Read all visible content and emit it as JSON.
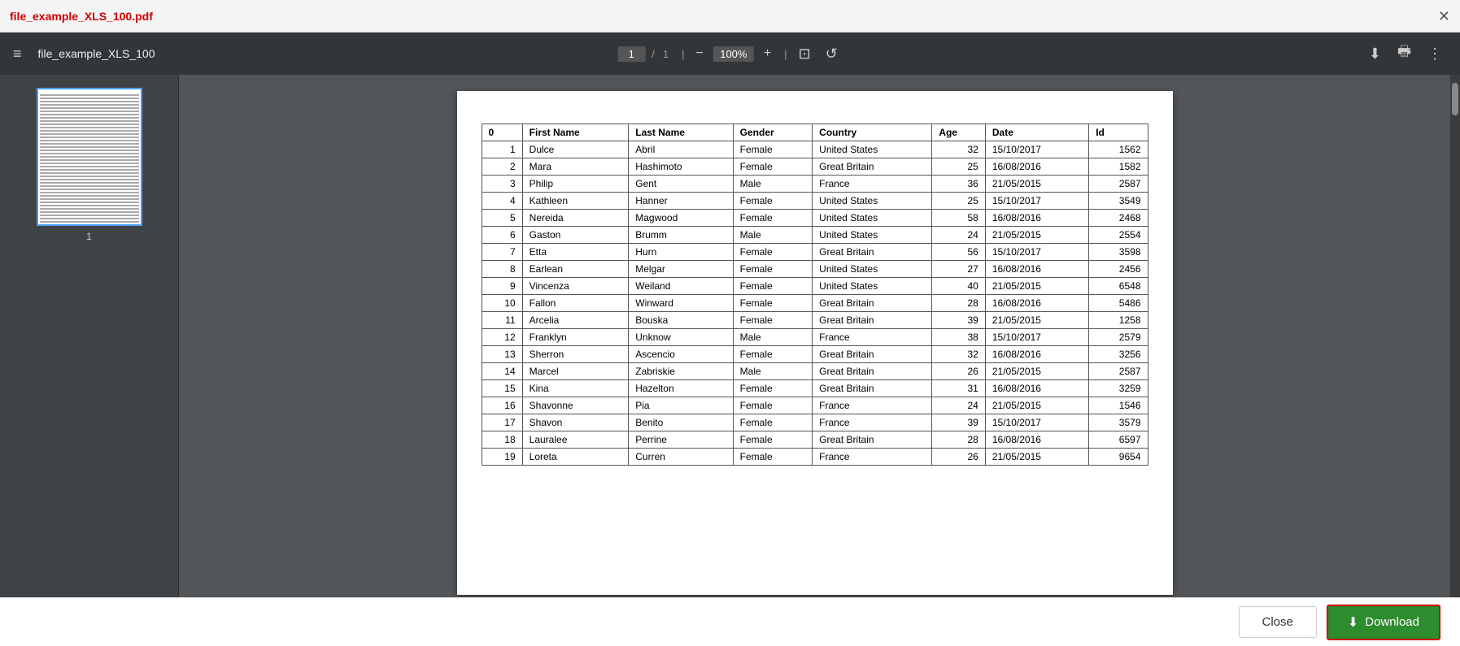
{
  "titleBar": {
    "filename": "file_example_XLS_100.pdf",
    "closeLabel": "✕"
  },
  "toolbar": {
    "hamburgerIcon": "≡",
    "filename": "file_example_XLS_100",
    "currentPage": "1",
    "totalPages": "1",
    "zoomPercent": "100%",
    "zoomOutLabel": "−",
    "zoomInLabel": "+",
    "fitPageIcon": "⊡",
    "rotateIcon": "↺",
    "downloadIcon": "⬇",
    "printIcon": "🖶",
    "moreIcon": "⋮"
  },
  "sidebar": {
    "pageNumber": "1"
  },
  "table": {
    "headers": [
      "0",
      "First Name",
      "Last Name",
      "Gender",
      "Country",
      "Age",
      "Date",
      "Id"
    ],
    "rows": [
      [
        "1",
        "Dulce",
        "Abril",
        "Female",
        "United States",
        "32",
        "15/10/2017",
        "1562"
      ],
      [
        "2",
        "Mara",
        "Hashimoto",
        "Female",
        "Great Britain",
        "25",
        "16/08/2016",
        "1582"
      ],
      [
        "3",
        "Philip",
        "Gent",
        "Male",
        "France",
        "36",
        "21/05/2015",
        "2587"
      ],
      [
        "4",
        "Kathleen",
        "Hanner",
        "Female",
        "United States",
        "25",
        "15/10/2017",
        "3549"
      ],
      [
        "5",
        "Nereida",
        "Magwood",
        "Female",
        "United States",
        "58",
        "16/08/2016",
        "2468"
      ],
      [
        "6",
        "Gaston",
        "Brumm",
        "Male",
        "United States",
        "24",
        "21/05/2015",
        "2554"
      ],
      [
        "7",
        "Etta",
        "Hurn",
        "Female",
        "Great Britain",
        "56",
        "15/10/2017",
        "3598"
      ],
      [
        "8",
        "Earlean",
        "Melgar",
        "Female",
        "United States",
        "27",
        "16/08/2016",
        "2456"
      ],
      [
        "9",
        "Vincenza",
        "Weiland",
        "Female",
        "United States",
        "40",
        "21/05/2015",
        "6548"
      ],
      [
        "10",
        "Fallon",
        "Winward",
        "Female",
        "Great Britain",
        "28",
        "16/08/2016",
        "5486"
      ],
      [
        "11",
        "Arcelia",
        "Bouska",
        "Female",
        "Great Britain",
        "39",
        "21/05/2015",
        "1258"
      ],
      [
        "12",
        "Franklyn",
        "Unknow",
        "Male",
        "France",
        "38",
        "15/10/2017",
        "2579"
      ],
      [
        "13",
        "Sherron",
        "Ascencio",
        "Female",
        "Great Britain",
        "32",
        "16/08/2016",
        "3256"
      ],
      [
        "14",
        "Marcel",
        "Zabriskie",
        "Male",
        "Great Britain",
        "26",
        "21/05/2015",
        "2587"
      ],
      [
        "15",
        "Kina",
        "Hazelton",
        "Female",
        "Great Britain",
        "31",
        "16/08/2016",
        "3259"
      ],
      [
        "16",
        "Shavonne",
        "Pia",
        "Female",
        "France",
        "24",
        "21/05/2015",
        "1546"
      ],
      [
        "17",
        "Shavon",
        "Benito",
        "Female",
        "France",
        "39",
        "15/10/2017",
        "3579"
      ],
      [
        "18",
        "Lauralee",
        "Perrine",
        "Female",
        "Great Britain",
        "28",
        "16/08/2016",
        "6597"
      ],
      [
        "19",
        "Loreta",
        "Curren",
        "Female",
        "France",
        "26",
        "21/05/2015",
        "9654"
      ]
    ]
  },
  "bottomBar": {
    "closeLabel": "Close",
    "downloadLabel": "Download",
    "downloadIconUnicode": "⬇"
  }
}
